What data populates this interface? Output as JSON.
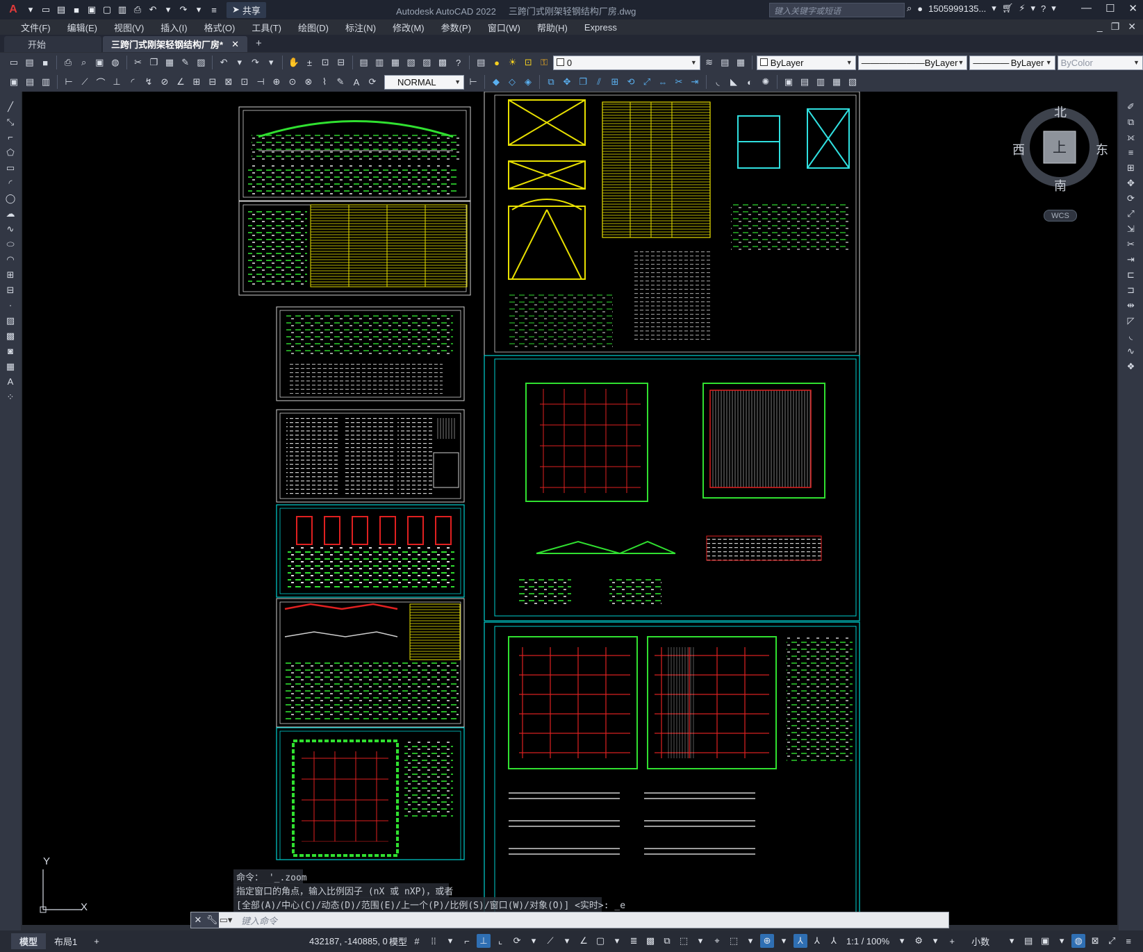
{
  "titlebar": {
    "app_title": "Autodesk AutoCAD 2022",
    "file_name": "三跨门式刚架轻钢结构厂房.dwg",
    "share_label": "共享",
    "search_placeholder": "键入关键字或短语",
    "user_name": "1505999135..."
  },
  "menu": [
    "文件(F)",
    "编辑(E)",
    "视图(V)",
    "插入(I)",
    "格式(O)",
    "工具(T)",
    "绘图(D)",
    "标注(N)",
    "修改(M)",
    "参数(P)",
    "窗口(W)",
    "帮助(H)",
    "Express"
  ],
  "tabs": {
    "start": "开始",
    "drawing": "三跨门式刚架轻钢结构厂房*",
    "add": "+"
  },
  "toolbar": {
    "layer_value": "0",
    "color_value": "ByLayer",
    "linetype_value": "ByLayer",
    "lineweight_value": "ByLayer",
    "plotstyle_value": "ByColor",
    "textstyle_value": "NORMAL"
  },
  "viewcube": {
    "north": "北",
    "south": "南",
    "east": "东",
    "west": "西",
    "top": "上",
    "wcs": "WCS"
  },
  "ucs": {
    "x": "X",
    "y": "Y"
  },
  "command": {
    "history": [
      "命令：  '_.zoom",
      "指定窗口的角点，输入比例因子 (nX 或 nXP)，或者",
      "[全部(A)/中心(C)/动态(D)/范围(E)/上一个(P)/比例(S)/窗口(W)/对象(O)] <实时>: _e"
    ],
    "placeholder": "键入命令"
  },
  "status": {
    "model_tab": "模型",
    "layout_tab": "布局1",
    "add_tab": "+",
    "coords": "432187, -140885, 0",
    "model_label": "模型",
    "scale": "1:1 / 100%",
    "units": "小数"
  },
  "colors": {
    "canvas": "#000000",
    "frame_cyan": "#00d0d0",
    "frame_white": "#d0d0d0",
    "grid_red": "#e02020",
    "grid_green": "#20e020",
    "yellow": "#f0f000"
  }
}
